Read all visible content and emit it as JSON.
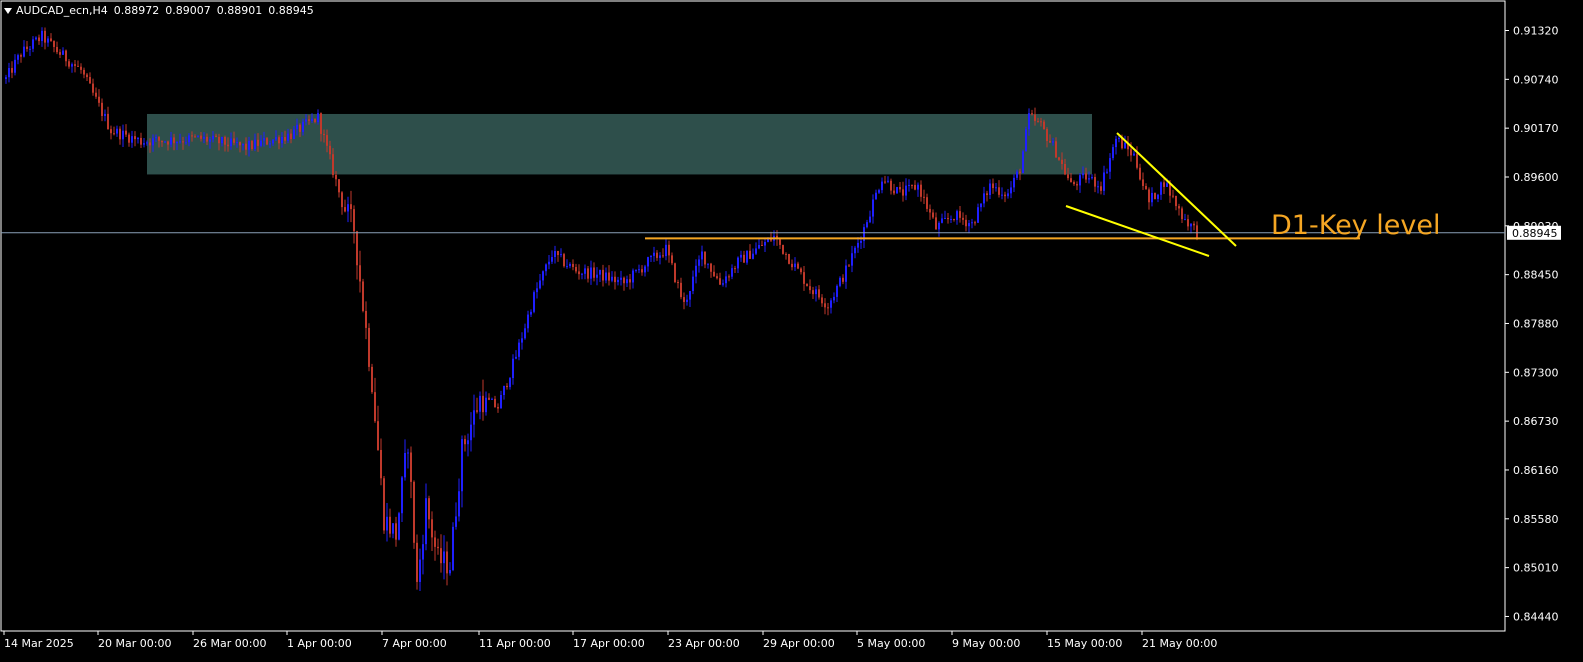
{
  "header": {
    "symbol": "AUDCAD_ecn,H4",
    "ohlc": [
      "0.88972",
      "0.89007",
      "0.88901",
      "0.88945"
    ]
  },
  "chart_data": {
    "type": "candlestick",
    "symbol": "AUDCAD_ecn",
    "timeframe": "H4",
    "ylim": [
      0.8415,
      0.916
    ],
    "y_ticks": [
      "0.91320",
      "0.90740",
      "0.90170",
      "0.89600",
      "0.89030",
      "0.88450",
      "0.87880",
      "0.87300",
      "0.86730",
      "0.86160",
      "0.85580",
      "0.85010",
      "0.84440"
    ],
    "x_labels": [
      "14 Mar 2025",
      "20 Mar 00:00",
      "26 Mar 00:00",
      "1 Apr 00:00",
      "7 Apr 00:00",
      "11 Apr 00:00",
      "17 Apr 00:00",
      "23 Apr 00:00",
      "29 Apr 00:00",
      "5 May 00:00",
      "9 May 00:00",
      "15 May 00:00",
      "21 May 00:00"
    ],
    "current_price": "0.88945",
    "annotation": "D1-Key level",
    "key_level": 0.8888,
    "supply_zone": {
      "from": 0.8963,
      "to": 0.9034
    },
    "path_anchors": [
      {
        "i": 0,
        "p": 0.9075
      },
      {
        "i": 5,
        "p": 0.9105
      },
      {
        "i": 12,
        "p": 0.9125
      },
      {
        "i": 17,
        "p": 0.9108
      },
      {
        "i": 25,
        "p": 0.9085
      },
      {
        "i": 35,
        "p": 0.9015
      },
      {
        "i": 45,
        "p": 0.9002
      },
      {
        "i": 65,
        "p": 0.9005
      },
      {
        "i": 80,
        "p": 0.8995
      },
      {
        "i": 95,
        "p": 0.901
      },
      {
        "i": 104,
        "p": 0.903
      },
      {
        "i": 112,
        "p": 0.893
      },
      {
        "i": 116,
        "p": 0.89
      },
      {
        "i": 122,
        "p": 0.872
      },
      {
        "i": 126,
        "p": 0.856
      },
      {
        "i": 130,
        "p": 0.854
      },
      {
        "i": 134,
        "p": 0.865
      },
      {
        "i": 137,
        "p": 0.848
      },
      {
        "i": 140,
        "p": 0.8575
      },
      {
        "i": 144,
        "p": 0.851
      },
      {
        "i": 148,
        "p": 0.8505
      },
      {
        "i": 152,
        "p": 0.864
      },
      {
        "i": 158,
        "p": 0.87
      },
      {
        "i": 164,
        "p": 0.869
      },
      {
        "i": 170,
        "p": 0.875
      },
      {
        "i": 176,
        "p": 0.882
      },
      {
        "i": 182,
        "p": 0.887
      },
      {
        "i": 190,
        "p": 0.885
      },
      {
        "i": 198,
        "p": 0.8845
      },
      {
        "i": 206,
        "p": 0.8835
      },
      {
        "i": 214,
        "p": 0.886
      },
      {
        "i": 220,
        "p": 0.8875
      },
      {
        "i": 226,
        "p": 0.881
      },
      {
        "i": 232,
        "p": 0.887
      },
      {
        "i": 238,
        "p": 0.8835
      },
      {
        "i": 244,
        "p": 0.886
      },
      {
        "i": 250,
        "p": 0.8875
      },
      {
        "i": 256,
        "p": 0.889
      },
      {
        "i": 262,
        "p": 0.886
      },
      {
        "i": 268,
        "p": 0.883
      },
      {
        "i": 274,
        "p": 0.881
      },
      {
        "i": 280,
        "p": 0.885
      },
      {
        "i": 286,
        "p": 0.89
      },
      {
        "i": 292,
        "p": 0.896
      },
      {
        "i": 298,
        "p": 0.894
      },
      {
        "i": 304,
        "p": 0.895
      },
      {
        "i": 310,
        "p": 0.89
      },
      {
        "i": 316,
        "p": 0.8915
      },
      {
        "i": 322,
        "p": 0.8905
      },
      {
        "i": 328,
        "p": 0.895
      },
      {
        "i": 334,
        "p": 0.894
      },
      {
        "i": 338,
        "p": 0.897
      },
      {
        "i": 341,
        "p": 0.903
      },
      {
        "i": 345,
        "p": 0.902
      },
      {
        "i": 350,
        "p": 0.899
      },
      {
        "i": 355,
        "p": 0.895
      },
      {
        "i": 360,
        "p": 0.896
      },
      {
        "i": 365,
        "p": 0.895
      },
      {
        "i": 370,
        "p": 0.9005
      },
      {
        "i": 376,
        "p": 0.8985
      },
      {
        "i": 381,
        "p": 0.893
      },
      {
        "i": 386,
        "p": 0.8955
      },
      {
        "i": 392,
        "p": 0.8915
      },
      {
        "i": 397,
        "p": 0.8895
      }
    ],
    "candle_count": 398
  }
}
